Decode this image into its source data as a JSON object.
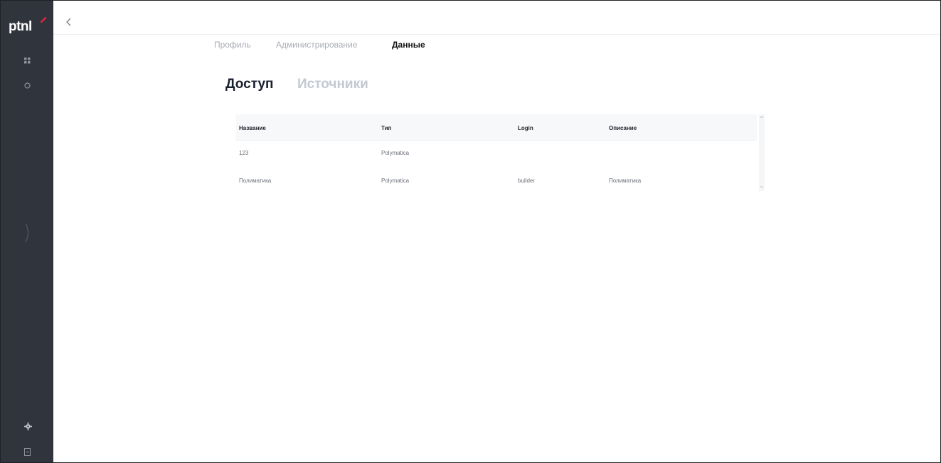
{
  "sidebar": {
    "logo_text": "ptnl",
    "logo_accent_color": "#e0253a",
    "icons": [
      "grid-icon",
      "circle-icon",
      "collapse-arrow-icon",
      "gear-icon",
      "exit-icon"
    ]
  },
  "header": {
    "back_icon": "chevron-left-icon"
  },
  "top_tabs": [
    {
      "label": "Профиль",
      "active": false
    },
    {
      "label": "Администрирование",
      "active": false
    },
    {
      "label": "Данные",
      "active": true
    }
  ],
  "sub_tabs": [
    {
      "label": "Доступ",
      "active": true
    },
    {
      "label": "Источники",
      "active": false
    }
  ],
  "table": {
    "columns": [
      "Название",
      "Тип",
      "Login",
      "Описание"
    ],
    "rows": [
      [
        "123",
        "Polymatica",
        "",
        ""
      ],
      [
        "Полиматика",
        "Polymatica",
        "builder",
        "Полиматика"
      ]
    ]
  }
}
